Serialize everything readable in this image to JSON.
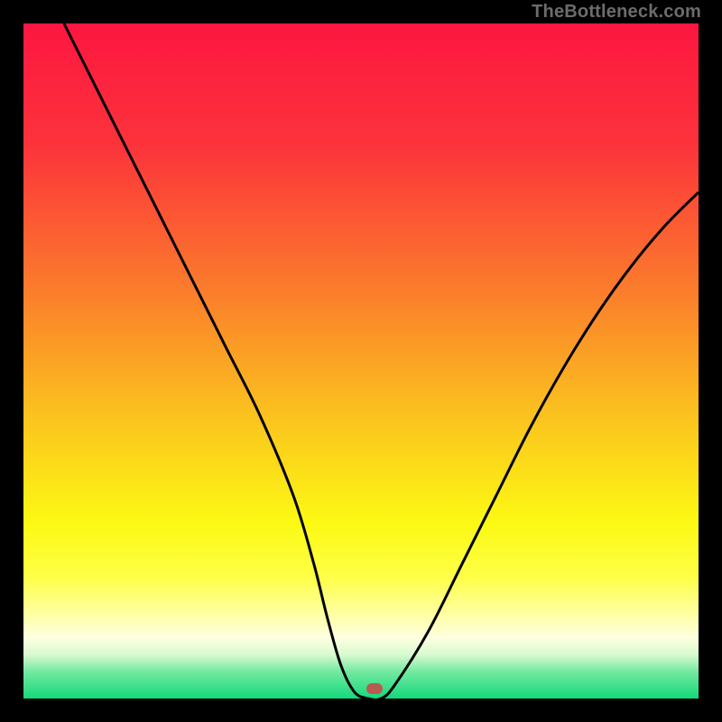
{
  "watermark": "TheBottleneck.com",
  "chart_data": {
    "type": "line",
    "title": "",
    "xlabel": "",
    "ylabel": "",
    "xlim": [
      0,
      100
    ],
    "ylim": [
      0,
      100
    ],
    "grid": false,
    "legend": false,
    "series": [
      {
        "name": "bottleneck-curve",
        "x": [
          6,
          10,
          15,
          20,
          25,
          30,
          35,
          40,
          43,
          45,
          47,
          49,
          51,
          53,
          55,
          60,
          65,
          70,
          75,
          80,
          85,
          90,
          95,
          100
        ],
        "values": [
          100,
          92,
          82,
          72,
          62,
          52,
          42,
          30,
          20,
          12,
          5,
          1,
          0,
          0,
          2,
          10,
          20,
          30,
          40,
          49,
          57,
          64,
          70,
          75
        ]
      }
    ],
    "marker": {
      "x": 52,
      "y_pct_from_top": 98.5,
      "color": "#b85a52"
    },
    "gradient_stops": [
      {
        "offset": 0,
        "color": "#fd1640"
      },
      {
        "offset": 18,
        "color": "#fc333b"
      },
      {
        "offset": 40,
        "color": "#fb7e2b"
      },
      {
        "offset": 58,
        "color": "#fbc21e"
      },
      {
        "offset": 74,
        "color": "#fcf913"
      },
      {
        "offset": 82,
        "color": "#feff47"
      },
      {
        "offset": 88,
        "color": "#ffffac"
      },
      {
        "offset": 91,
        "color": "#fdffe0"
      },
      {
        "offset": 93.5,
        "color": "#d9fad0"
      },
      {
        "offset": 96,
        "color": "#74e9a0"
      },
      {
        "offset": 100,
        "color": "#12d97c"
      }
    ],
    "curve_color": "#000000",
    "curve_width": 3
  }
}
